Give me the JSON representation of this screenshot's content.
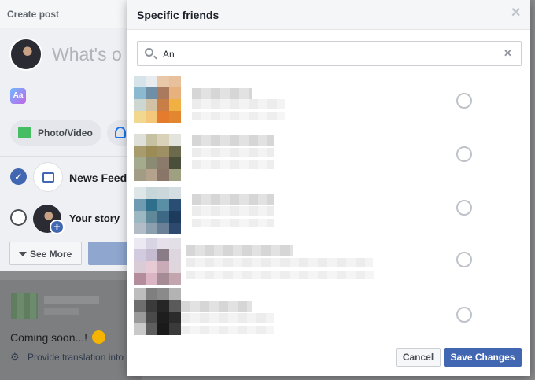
{
  "colors": {
    "accent": "#4267b2",
    "backdrop": "#8a8b8d",
    "radio_border": "#bec2c9"
  },
  "background_card": {
    "header": "Create post",
    "composer_placeholder": "What's o",
    "aa_label": "Aa",
    "photo_video_label": "Photo/Video",
    "audience": [
      {
        "label": "News Feed",
        "selected": true,
        "icon": "news-feed-icon"
      },
      {
        "label": "Your story",
        "selected": false,
        "icon": "story-avatar"
      }
    ],
    "see_more_label": "See More"
  },
  "background_post": {
    "text": "Coming soon...!",
    "translation_text": "Provide translation into"
  },
  "dialog": {
    "title": "Specific friends",
    "close_icon": "close-icon",
    "search": {
      "value": "An",
      "icon": "search-icon",
      "clear_icon": "clear-icon"
    },
    "friends": [
      {
        "selected": false,
        "pixels": [
          "#d6e4ea",
          "#e9ecef",
          "#e8c8a9",
          "#e9c09c",
          "#8bbad0",
          "#6e8fa6",
          "#a97a5d",
          "#e6b17d",
          "#cbd7d0",
          "#d2c2a5",
          "#c77e47",
          "#f0b043",
          "#f2d88f",
          "#f4c77b",
          "#e47b2d",
          "#e2872f"
        ]
      },
      {
        "selected": false,
        "pixels": [
          "#dfe0da",
          "#c6c1a3",
          "#d9d1b8",
          "#e4e4de",
          "#a89b6e",
          "#9b8b54",
          "#9e9064",
          "#6c6a4c",
          "#a4aa8e",
          "#8b8b74",
          "#8c7b6b",
          "#4a4f3c",
          "#a29c85",
          "#b5a28d",
          "#8a7668",
          "#9ea081"
        ]
      },
      {
        "selected": false,
        "pixels": [
          "#dfe6e7",
          "#c7d6d9",
          "#cbd7da",
          "#d4dde2",
          "#6e9bb1",
          "#2e6f8b",
          "#5b8fa5",
          "#2a4e73",
          "#9ab7c2",
          "#5f8999",
          "#3d6986",
          "#1d3c5d",
          "#b2bcc7",
          "#8aa0ae",
          "#6a8097",
          "#2d4a6e"
        ]
      },
      {
        "selected": false,
        "pixels": [
          "#ece9f2",
          "#d9d4e3",
          "#e6e0ea",
          "#e3dfe6",
          "#d2cbe0",
          "#c5bcd2",
          "#8a7c86",
          "#ddd6df",
          "#d9ccd6",
          "#e6cbd5",
          "#c9aab7",
          "#dfd5dc",
          "#b48d9d",
          "#dcb5c5",
          "#a58c94",
          "#c2a5ad"
        ]
      },
      {
        "selected": false,
        "pixels": [
          "#bdbdbd",
          "#7f7f7f",
          "#8a8a8a",
          "#b3b3b3",
          "#6e6e6e",
          "#3b3b3b",
          "#262626",
          "#5a5a5a",
          "#9a9a9a",
          "#4a4a4a",
          "#1e1e1e",
          "#2b2b2b",
          "#c9c9c9",
          "#5e5e5e",
          "#1a1a1a",
          "#3a3a3a"
        ]
      }
    ],
    "cancel_label": "Cancel",
    "save_label": "Save Changes"
  }
}
